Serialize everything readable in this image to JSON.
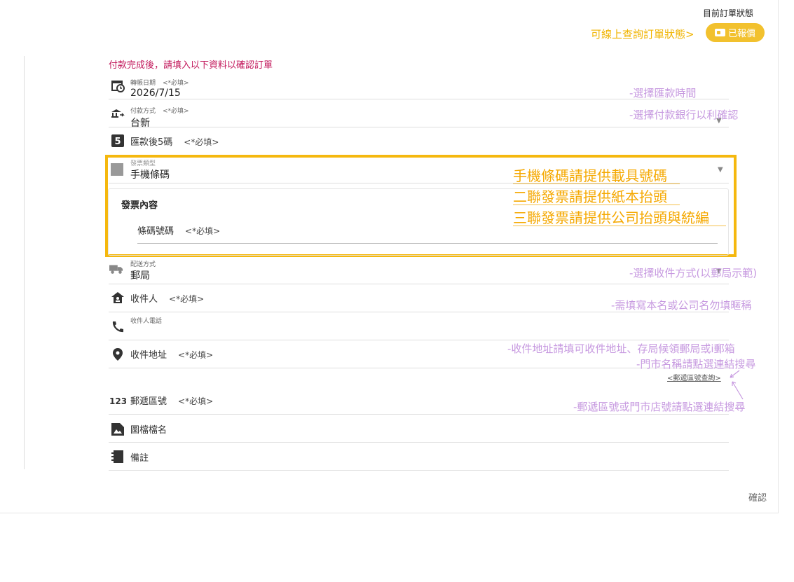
{
  "status": {
    "title": "目前訂單狀態",
    "hint": "可線上查詢訂單狀態>",
    "badge": "已報價",
    "badge_color": "#f2c12e"
  },
  "notice": "付款完成後，請填入以下資料以確認訂單",
  "fields": {
    "transfer_date": {
      "label": "轉帳日期",
      "req": "<*必填>",
      "value": "2026/7/15",
      "icon": "calendar-clock-icon"
    },
    "pay_method": {
      "label": "付款方式",
      "req": "<*必填>",
      "value": "台新",
      "icon": "bank-transfer-icon"
    },
    "last5": {
      "label": "匯款後5碼",
      "req": "<*必填>",
      "icon": "number-five-icon"
    },
    "invoice_type": {
      "label": "發票類型",
      "value": "手機條碼",
      "icon": "receipt-icon"
    },
    "invoice_content": {
      "title": "發票內容",
      "label": "條碼號碼",
      "req": "<*必填>"
    },
    "ship_method": {
      "label": "配送方式",
      "value": "郵局",
      "icon": "truck-icon"
    },
    "recipient": {
      "label": "收件人",
      "req": "<*必填>",
      "icon": "house-user-icon"
    },
    "phone": {
      "label": "收件人電話",
      "icon": "phone-icon"
    },
    "address": {
      "label": "收件地址",
      "req": "<*必填>",
      "icon": "location-pin-icon"
    },
    "zip_link": "<郵遞區號查詢>",
    "zip": {
      "label": "郵遞區號",
      "req": "<*必填>",
      "icon": "numeric-123-icon"
    },
    "image_file": {
      "label": "圖檔檔名",
      "icon": "image-file-icon"
    },
    "note": {
      "label": "備註",
      "icon": "notebook-icon"
    }
  },
  "annotations": {
    "a1": "-選擇匯款時間",
    "a2": "-選擇付款銀行以利確認",
    "a3": "-選擇收件方式(以郵局示範)",
    "a4": "-需填寫本名或公司名勿填暱稱",
    "a5": "-收件地址請填可收件地址、存局候領郵局或i郵箱",
    "a6": "-門市名稱請點選連結搜尋",
    "a7": "-郵遞區號或門市店號請點選連結搜尋"
  },
  "invoice_hints": {
    "h1": "手機條碼請提供載具號碼",
    "h2": "二聯發票請提供紙本抬頭",
    "h3": "三聯發票請提供公司抬頭與統編"
  },
  "confirm": "確認"
}
